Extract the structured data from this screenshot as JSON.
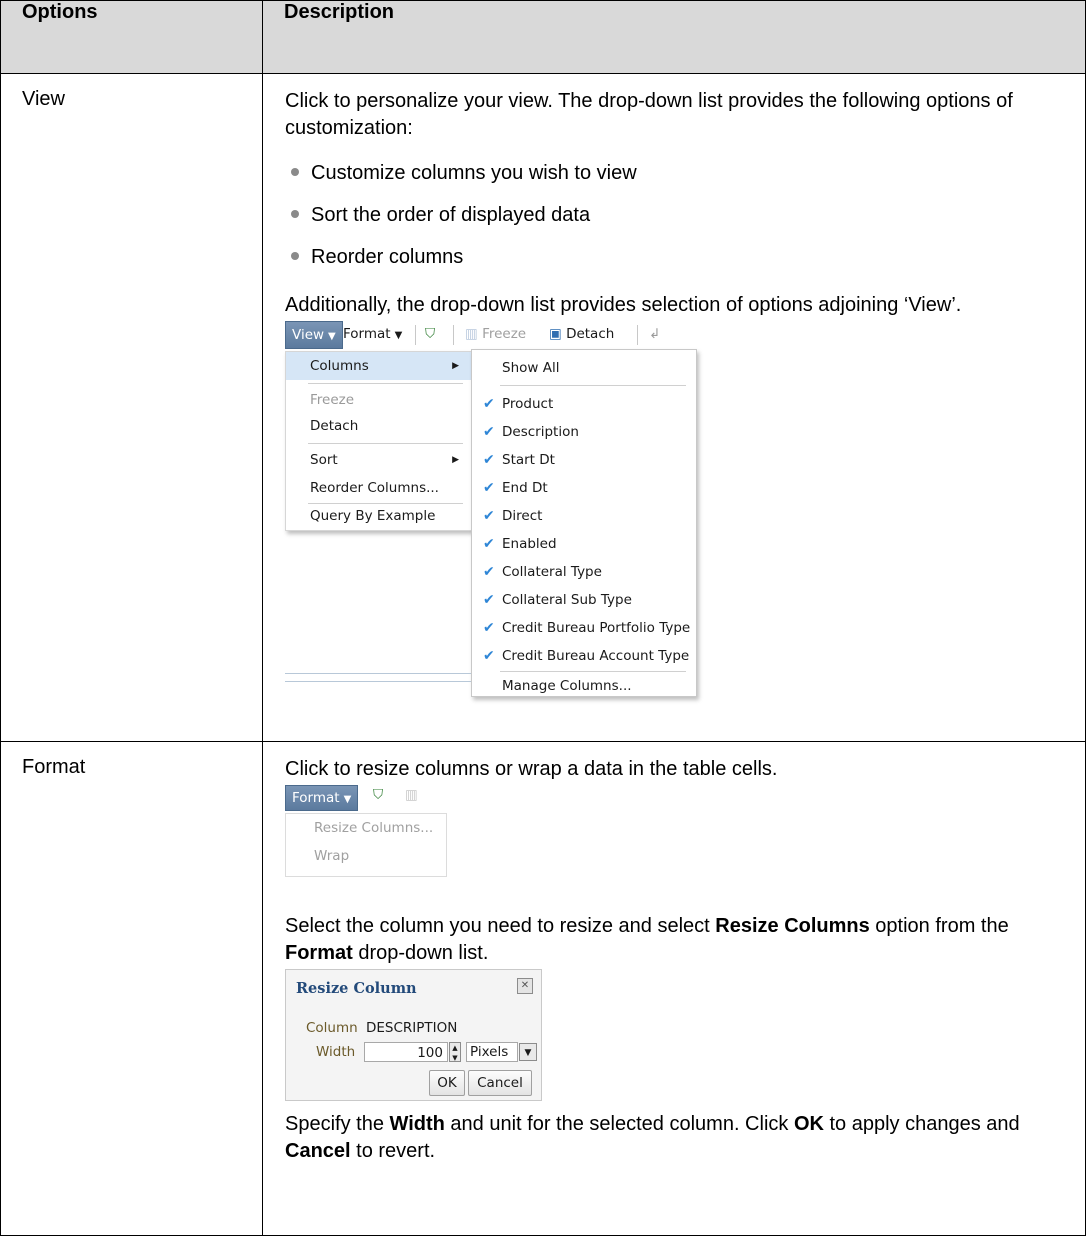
{
  "table": {
    "headers": {
      "options": "Options",
      "description": "Description"
    }
  },
  "view_row": {
    "option": "View",
    "intro": "Click to personalize your view. The drop-down list provides the following options of customization:",
    "bullets": [
      "Customize columns you wish to view",
      "Sort the order of displayed data",
      "Reorder columns"
    ],
    "additional": "Additionally, the drop-down list provides selection of options adjoining ‘View’."
  },
  "view_screenshot": {
    "toolbar": {
      "view": "View",
      "format": "Format",
      "freeze": "Freeze",
      "detach": "Detach"
    },
    "menu": {
      "columns": "Columns",
      "freeze": "Freeze",
      "detach": "Detach",
      "sort": "Sort",
      "reorder": "Reorder Columns...",
      "qbe": "Query By Example"
    },
    "submenu": {
      "show_all": "Show All",
      "items": [
        "Product",
        "Description",
        "Start Dt",
        "End Dt",
        "Direct",
        "Enabled",
        "Collateral Type",
        "Collateral Sub Type",
        "Credit Bureau Portfolio Type",
        "Credit Bureau Account Type"
      ],
      "manage": "Manage Columns..."
    }
  },
  "format_row": {
    "option": "Format",
    "intro": "Click to resize columns or wrap a data in the table cells.",
    "select_pre": "Select the column you need to resize and select ",
    "select_bold1": "Resize Columns",
    "select_mid": " option from the ",
    "select_bold2": "Format",
    "select_post": " drop-down list.",
    "spec_pre": "Specify the ",
    "spec_bold1": "Width",
    "spec_mid1": " and unit for the selected column. Click ",
    "spec_bold2": "OK",
    "spec_mid2": " to apply changes and ",
    "spec_bold3": "Cancel",
    "spec_post": " to revert."
  },
  "format_screenshot": {
    "button": "Format",
    "items": [
      "Resize Columns...",
      "Wrap"
    ]
  },
  "dialog": {
    "title": "Resize Column",
    "column_label": "Column",
    "column_value": "DESCRIPTION",
    "width_label": "Width",
    "width_value": "100",
    "unit": "Pixels",
    "ok": "OK",
    "cancel": "Cancel"
  }
}
